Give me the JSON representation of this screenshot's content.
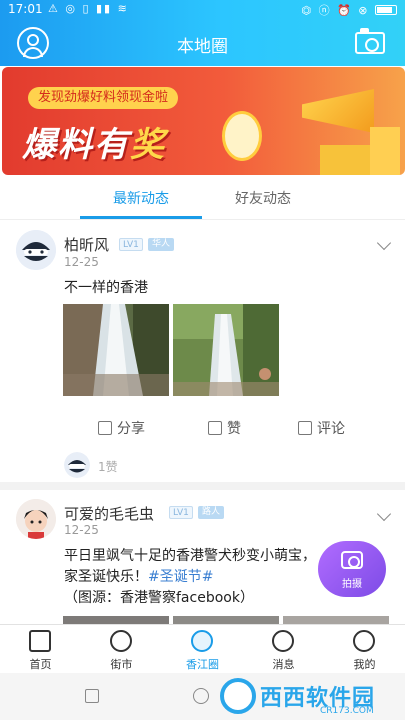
{
  "status_bar": {
    "time": "17:01",
    "left_icons": "⚠ ◎ ▯ ▮▮ ≋",
    "right_icons": "⏣ ⓝ ⏰ ⊗"
  },
  "header": {
    "title": "本地圈"
  },
  "banner": {
    "tagline": "发现劲爆好料领现金啦",
    "headline_a": "爆料有",
    "headline_b": "奖"
  },
  "tabs": [
    {
      "label": "最新动态",
      "active": true
    },
    {
      "label": "好友动态",
      "active": false
    }
  ],
  "posts": [
    {
      "author": "柏昕风",
      "level": "LV1",
      "role": "华人",
      "date": "12-25",
      "text": "不一样的香港",
      "actions": {
        "share": "分享",
        "like": "赞",
        "comment": "评论"
      },
      "likes": "1赞"
    },
    {
      "author": "可爱的毛毛虫",
      "level": "LV1",
      "role": "路人",
      "date": "12-25",
      "text_line1": "平日里飒气十足的香港警犬秒变小萌宝，",
      "text_line2_prefix": "家圣诞快乐！",
      "hashtag": "#圣诞节#",
      "text_line3": "（图源：香港警察facebook）"
    }
  ],
  "fab": {
    "label": "拍摄"
  },
  "bottom_nav": [
    {
      "label": "首页",
      "icon": "home-icon",
      "active": false
    },
    {
      "label": "街市",
      "icon": "market-icon",
      "active": false
    },
    {
      "label": "香江圈",
      "icon": "circle-icon",
      "active": true
    },
    {
      "label": "消息",
      "icon": "message-icon",
      "active": false
    },
    {
      "label": "我的",
      "icon": "profile-icon",
      "active": false
    }
  ],
  "watermark": {
    "brand": "西西软件园",
    "url": "CR173.COM"
  },
  "colors": {
    "accent": "#1a9ce8",
    "header_start": "#1c9bf0",
    "header_end": "#32d1f7",
    "fab": "#9b5cf5"
  }
}
